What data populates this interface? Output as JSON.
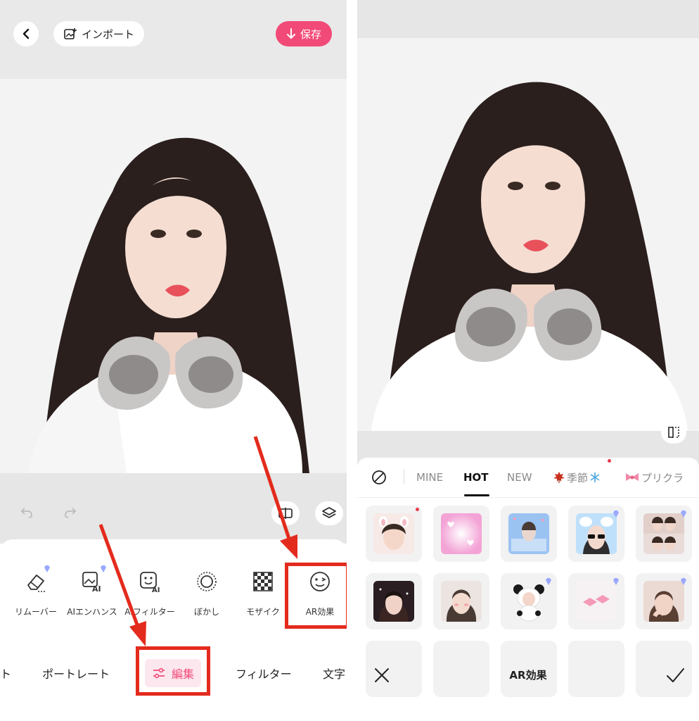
{
  "left": {
    "header": {
      "import_label": "インポート",
      "save_label": "保存"
    },
    "tools": [
      {
        "label": "リムーバー",
        "icon": "eraser-icon",
        "premium": true
      },
      {
        "label": "AIエンハンス",
        "icon": "ai-enhance-icon",
        "premium": true
      },
      {
        "label": "AIフィルター",
        "icon": "ai-filter-icon",
        "premium": false
      },
      {
        "label": "ぼかし",
        "icon": "blur-icon",
        "premium": false
      },
      {
        "label": "モザイク",
        "icon": "mosaic-icon",
        "premium": false
      },
      {
        "label": "AR効果",
        "icon": "smile-icon",
        "premium": false
      }
    ],
    "bottom_tabs": [
      {
        "label": "ト"
      },
      {
        "label": "ポートレート"
      },
      {
        "label": "編集",
        "active": true
      },
      {
        "label": "フィルター"
      },
      {
        "label": "文字"
      }
    ]
  },
  "right": {
    "categories": [
      {
        "label": "MINE"
      },
      {
        "label": "HOT",
        "active": true
      },
      {
        "label": "NEW"
      },
      {
        "label": "季節",
        "icon": "maple-leaf-icon"
      },
      {
        "label": "プリクラ",
        "icon": "ribbon-icon"
      }
    ],
    "title": "AR効果"
  },
  "colors": {
    "accent_pink": "#f24a78",
    "annotation_red": "#e32b1d",
    "premium_gem": "#9aa8ff"
  }
}
